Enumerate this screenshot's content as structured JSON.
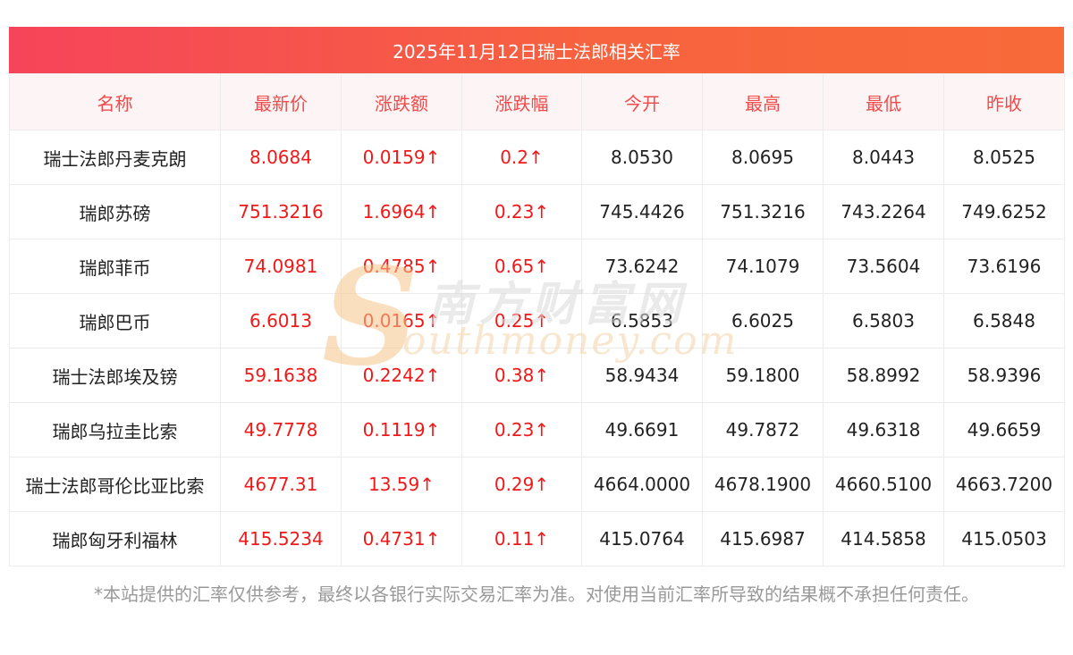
{
  "title": "2025年11月12日瑞士法郎相关汇率",
  "colors": {
    "header_gradient_start": "#f6445a",
    "header_gradient_end": "#f86a3a",
    "accent_red": "#f01919",
    "header_text": "#f04a4a"
  },
  "table": {
    "headers": [
      "名称",
      "最新价",
      "涨跌额",
      "涨跌幅",
      "今开",
      "最高",
      "最低",
      "昨收"
    ],
    "rows": [
      [
        "瑞士法郎丹麦克朗",
        "8.0684",
        "0.0159↑",
        "0.2↑",
        "8.0530",
        "8.0695",
        "8.0443",
        "8.0525"
      ],
      [
        "瑞郎苏磅",
        "751.3216",
        "1.6964↑",
        "0.23↑",
        "745.4426",
        "751.3216",
        "743.2264",
        "749.6252"
      ],
      [
        "瑞郎菲币",
        "74.0981",
        "0.4785↑",
        "0.65↑",
        "73.6242",
        "74.1079",
        "73.5604",
        "73.6196"
      ],
      [
        "瑞郎巴币",
        "6.6013",
        "0.0165↑",
        "0.25↑",
        "6.5853",
        "6.6025",
        "6.5803",
        "6.5848"
      ],
      [
        "瑞士法郎埃及镑",
        "59.1638",
        "0.2242↑",
        "0.38↑",
        "58.9434",
        "59.1800",
        "58.8992",
        "58.9396"
      ],
      [
        "瑞郎乌拉圭比索",
        "49.7778",
        "0.1119↑",
        "0.23↑",
        "49.6691",
        "49.7872",
        "49.6318",
        "49.6659"
      ],
      [
        "瑞士法郎哥伦比亚比索",
        "4677.31",
        "13.59↑",
        "0.29↑",
        "4664.0000",
        "4678.1900",
        "4660.5100",
        "4663.7200"
      ],
      [
        "瑞郎匈牙利福林",
        "415.5234",
        "0.4731↑",
        "0.11↑",
        "415.0764",
        "415.6987",
        "414.5858",
        "415.0503"
      ]
    ]
  },
  "watermark": {
    "cn": "南方财富网",
    "en": "outhmoney.com",
    "s": "S"
  },
  "footnote": "*本站提供的汇率仅供参考，最终以各银行实际交易汇率为准。对使用当前汇率所导致的结果概不承担任何责任。"
}
